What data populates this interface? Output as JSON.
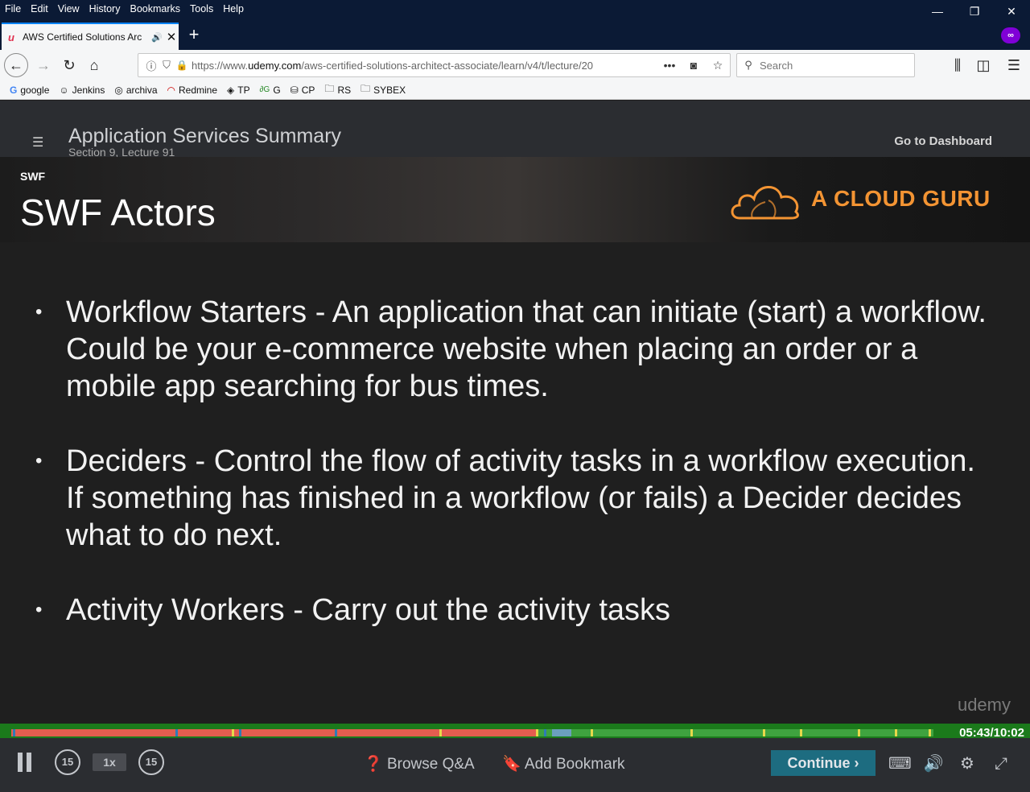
{
  "browser": {
    "menu": [
      "File",
      "Edit",
      "View",
      "History",
      "Bookmarks",
      "Tools",
      "Help"
    ],
    "window_controls": {
      "minimize": "—",
      "restore": "❐",
      "close": "✕"
    },
    "tab": {
      "title": "AWS Certified Solutions Arc",
      "favicon": "u",
      "audio_icon": "speaker-icon",
      "close": "✕"
    },
    "newtab": "+",
    "private_badge": "∞",
    "url": {
      "prefix": "https://www.",
      "domain": "udemy.com",
      "path": "/aws-certified-solutions-architect-associate/learn/v4/t/lecture/20"
    },
    "search": {
      "placeholder": "Search"
    },
    "bookmarks": [
      {
        "label": "google",
        "icon": "G"
      },
      {
        "label": "Jenkins",
        "icon": "☺"
      },
      {
        "label": "archiva",
        "icon": "◎"
      },
      {
        "label": "Redmine",
        "icon": "◠"
      },
      {
        "label": "TP",
        "icon": "◈"
      },
      {
        "label": "G",
        "icon": "∂G"
      },
      {
        "label": "CP",
        "icon": "⛁"
      },
      {
        "label": "RS",
        "icon": "🗀"
      },
      {
        "label": "SYBEX",
        "icon": "🗀"
      }
    ]
  },
  "lecture": {
    "title": "Application Services Summary",
    "subtitle": "Section 9, Lecture 91",
    "dashboard_link": "Go to Dashboard"
  },
  "slide": {
    "topic": "SWF",
    "heading": "SWF Actors",
    "brand": "A CLOUD GURU",
    "bullets": [
      "Workflow Starters - An application that can initiate (start) a workflow. Could be your e-commerce website when placing an order or a mobile app searching for bus times.",
      "Deciders - Control the flow of activity tasks in a workflow execution. If something has finished in a workflow (or fails) a Decider decides what to do next.",
      "Activity Workers - Carry out the activity tasks"
    ],
    "watermark": "udemy"
  },
  "player": {
    "time": "05:43/10:02",
    "progress_fraction": 0.57,
    "rewind_label": "15",
    "forward_label": "15",
    "speed": "1x",
    "browse_qa": "Browse Q&A",
    "add_bookmark": "Add Bookmark",
    "continue": "Continue"
  }
}
